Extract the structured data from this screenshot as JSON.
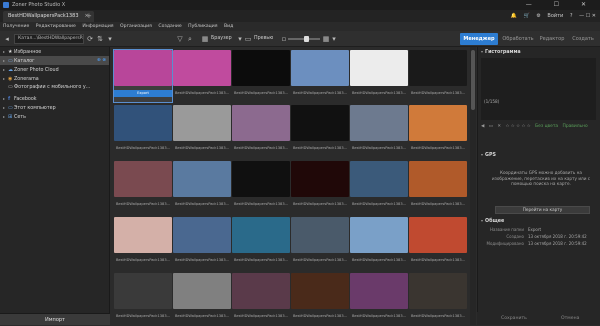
{
  "window": {
    "title": "Zoner Photo Studio X",
    "controls": "— ☐ ✕"
  },
  "tabs": {
    "active": "BestHDWallpapersPack1383",
    "close": "×",
    "add": "+",
    "right": {
      "user": "Войти",
      "icons": [
        "bell-icon",
        "cart-icon",
        "gear-icon",
        "help-icon"
      ]
    }
  },
  "menu": [
    "Получение",
    "Редактирование",
    "Информация",
    "Организация",
    "Создание",
    "Публикация",
    "Вид"
  ],
  "toolbar": {
    "path": "Катал...\\BestHDWallpapersPack1383",
    "browser_label": "Браузер",
    "preview_label": "Превью"
  },
  "modes": [
    "Менеджер",
    "Обработать",
    "Редактор",
    "Создать"
  ],
  "active_mode": "Менеджер",
  "nav": [
    {
      "label": "Избранное",
      "icon": "★",
      "arrow": "▸",
      "selected": false
    },
    {
      "label": "Каталог",
      "icon": "▭",
      "arrow": "▸",
      "selected": true,
      "extra": "⊕ ⊗"
    },
    {
      "label": "Zoner Photo Cloud",
      "icon": "☁",
      "arrow": "▸",
      "selected": false
    },
    {
      "label": "Zonerama",
      "icon": "◉",
      "arrow": "▸",
      "selected": false
    },
    {
      "label": "Фотографии с мобильного у...",
      "icon": "▭",
      "arrow": "",
      "selected": false
    },
    {
      "label": "Facebook",
      "icon": "f",
      "arrow": "▸",
      "selected": false
    },
    {
      "label": "Этот компьютер",
      "icon": "▭",
      "arrow": "▸",
      "selected": false
    },
    {
      "label": "Сеть",
      "icon": "⊞",
      "arrow": "▸",
      "selected": false
    }
  ],
  "import_label": "Импорт",
  "thumbnails": {
    "first_caption": "Export",
    "caption": "BestHDWallpapersPack1383...",
    "rows": [
      [
        "#b8469a",
        "#c04b9e",
        "#0c0c0c",
        "#6c8fbf",
        "#ececec",
        "#1a1a1a"
      ],
      [
        "#31527a",
        "#9a9a9a",
        "#8c6a8f",
        "#111111",
        "#6d7a8f",
        "#d07a3a"
      ],
      [
        "#7a4a50",
        "#5a7aa0",
        "#101010",
        "#200808",
        "#3b5a7a",
        "#b05a2a"
      ],
      [
        "#d4b0a8",
        "#4a6890",
        "#2a6a8a",
        "#4a5a6a",
        "#7aa0c8",
        "#c04a30"
      ],
      [
        "#3a3a3a",
        "#808080",
        "#5a3a4a",
        "#4a2a1a",
        "#6a3a6a",
        "#3a3530"
      ]
    ]
  },
  "right": {
    "histogram_title": "Гистограмма",
    "histogram_count": "(1/158)",
    "rating_row": [
      "◀",
      "▭",
      "✕",
      "☆ ☆ ☆ ☆ ☆",
      "Без цвета",
      "Правильно"
    ],
    "gps_title": "GPS",
    "gps_text": "Координаты GPS можно добавить на изображение, перетаскив их на карту или с помощью поиска на карте.",
    "gps_button": "Перейти на карту",
    "general_title": "Общее",
    "general": [
      {
        "k": "Название папки",
        "v": "Export"
      },
      {
        "k": "Создано",
        "v": "13 октября 2018 г. 20:59:42"
      },
      {
        "k": "Модифицировано",
        "v": "13 октября 2018 г. 20:59:42"
      }
    ],
    "bottom": {
      "save": "Сохранить",
      "cancel": "Отмена"
    }
  }
}
